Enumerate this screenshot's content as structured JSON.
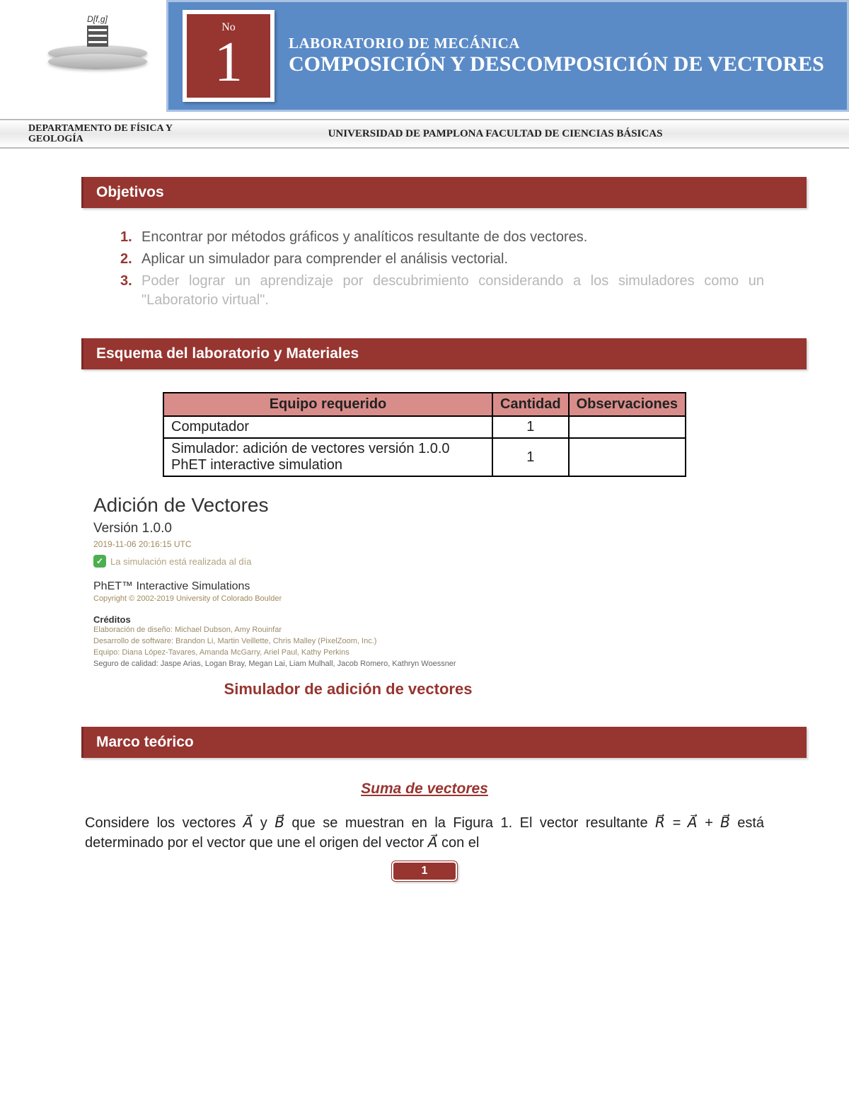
{
  "header": {
    "logo_label": "D[f,g]",
    "no_label": "No",
    "number": "1",
    "pretitle": "LABORATORIO DE MECÁNICA",
    "title": "COMPOSICIÓN Y DESCOMPOSICIÓN DE VECTORES"
  },
  "subband": {
    "dept": "DEPARTAMENTO DE FÍSICA Y GEOLOGÍA",
    "univ": "UNIVERSIDAD DE PAMPLONA FACULTAD DE CIENCIAS BÁSICAS"
  },
  "sections": {
    "objectives": "Objetivos",
    "schema": "Esquema del laboratorio y Materiales",
    "theory": "Marco teórico"
  },
  "objectives": [
    "Encontrar por métodos gráficos y analíticos resultante de dos vectores.",
    "Aplicar un simulador para comprender el análisis vectorial.",
    "Poder lograr un aprendizaje por descubrimiento considerando a los simuladores como un \"Laboratorio virtual\"."
  ],
  "table": {
    "headers": {
      "equip": "Equipo requerido",
      "qty": "Cantidad",
      "obs": "Observaciones"
    },
    "rows": [
      {
        "equip": "Computador",
        "qty": "1",
        "obs": ""
      },
      {
        "equip": "Simulador: adición de vectores versión 1.0.0 PhET interactive simulation",
        "qty": "1",
        "obs": ""
      }
    ]
  },
  "sim": {
    "title": "Adición de Vectores",
    "version": "Versión 1.0.0",
    "date": "2019-11-06 20:16:15 UTC",
    "status": "La simulación está realizada al día",
    "subtitle": "PhET™ Interactive Simulations",
    "copyright": "Copyright © 2002-2019 University of Colorado Boulder",
    "credits_h": "Créditos",
    "credits": {
      "l1": "Elaboración de diseño: Michael Dubson, Amy Rouinfar",
      "l2": "Desarrollo de software: Brandon Li, Martin Veillette, Chris Malley (PixelZoom, Inc.)",
      "l3": "Equipo: Diana López-Tavares, Amanda McGarry, Ariel Paul, Kathy Perkins",
      "l4": "Seguro de calidad: Jaspe Arias, Logan Bray, Megan Lai, Liam Mulhall, Jacob Romero, Kathryn Woessner"
    },
    "caption": "Simulador de adición de vectores"
  },
  "theory": {
    "subtitle": "Suma de vectores",
    "p1_a": "Considere los vectores ",
    "p1_b": " y ",
    "p1_c": " que se muestran en la Figura 1. El vector resultante ",
    "p1_d": " está determinado por el vector que une el origen del vector ",
    "p1_e": " con el",
    "vec_A": "A",
    "vec_B": "B",
    "vec_R": "R",
    "eq": " = A⃗ + B⃗"
  },
  "pagenum": "1"
}
